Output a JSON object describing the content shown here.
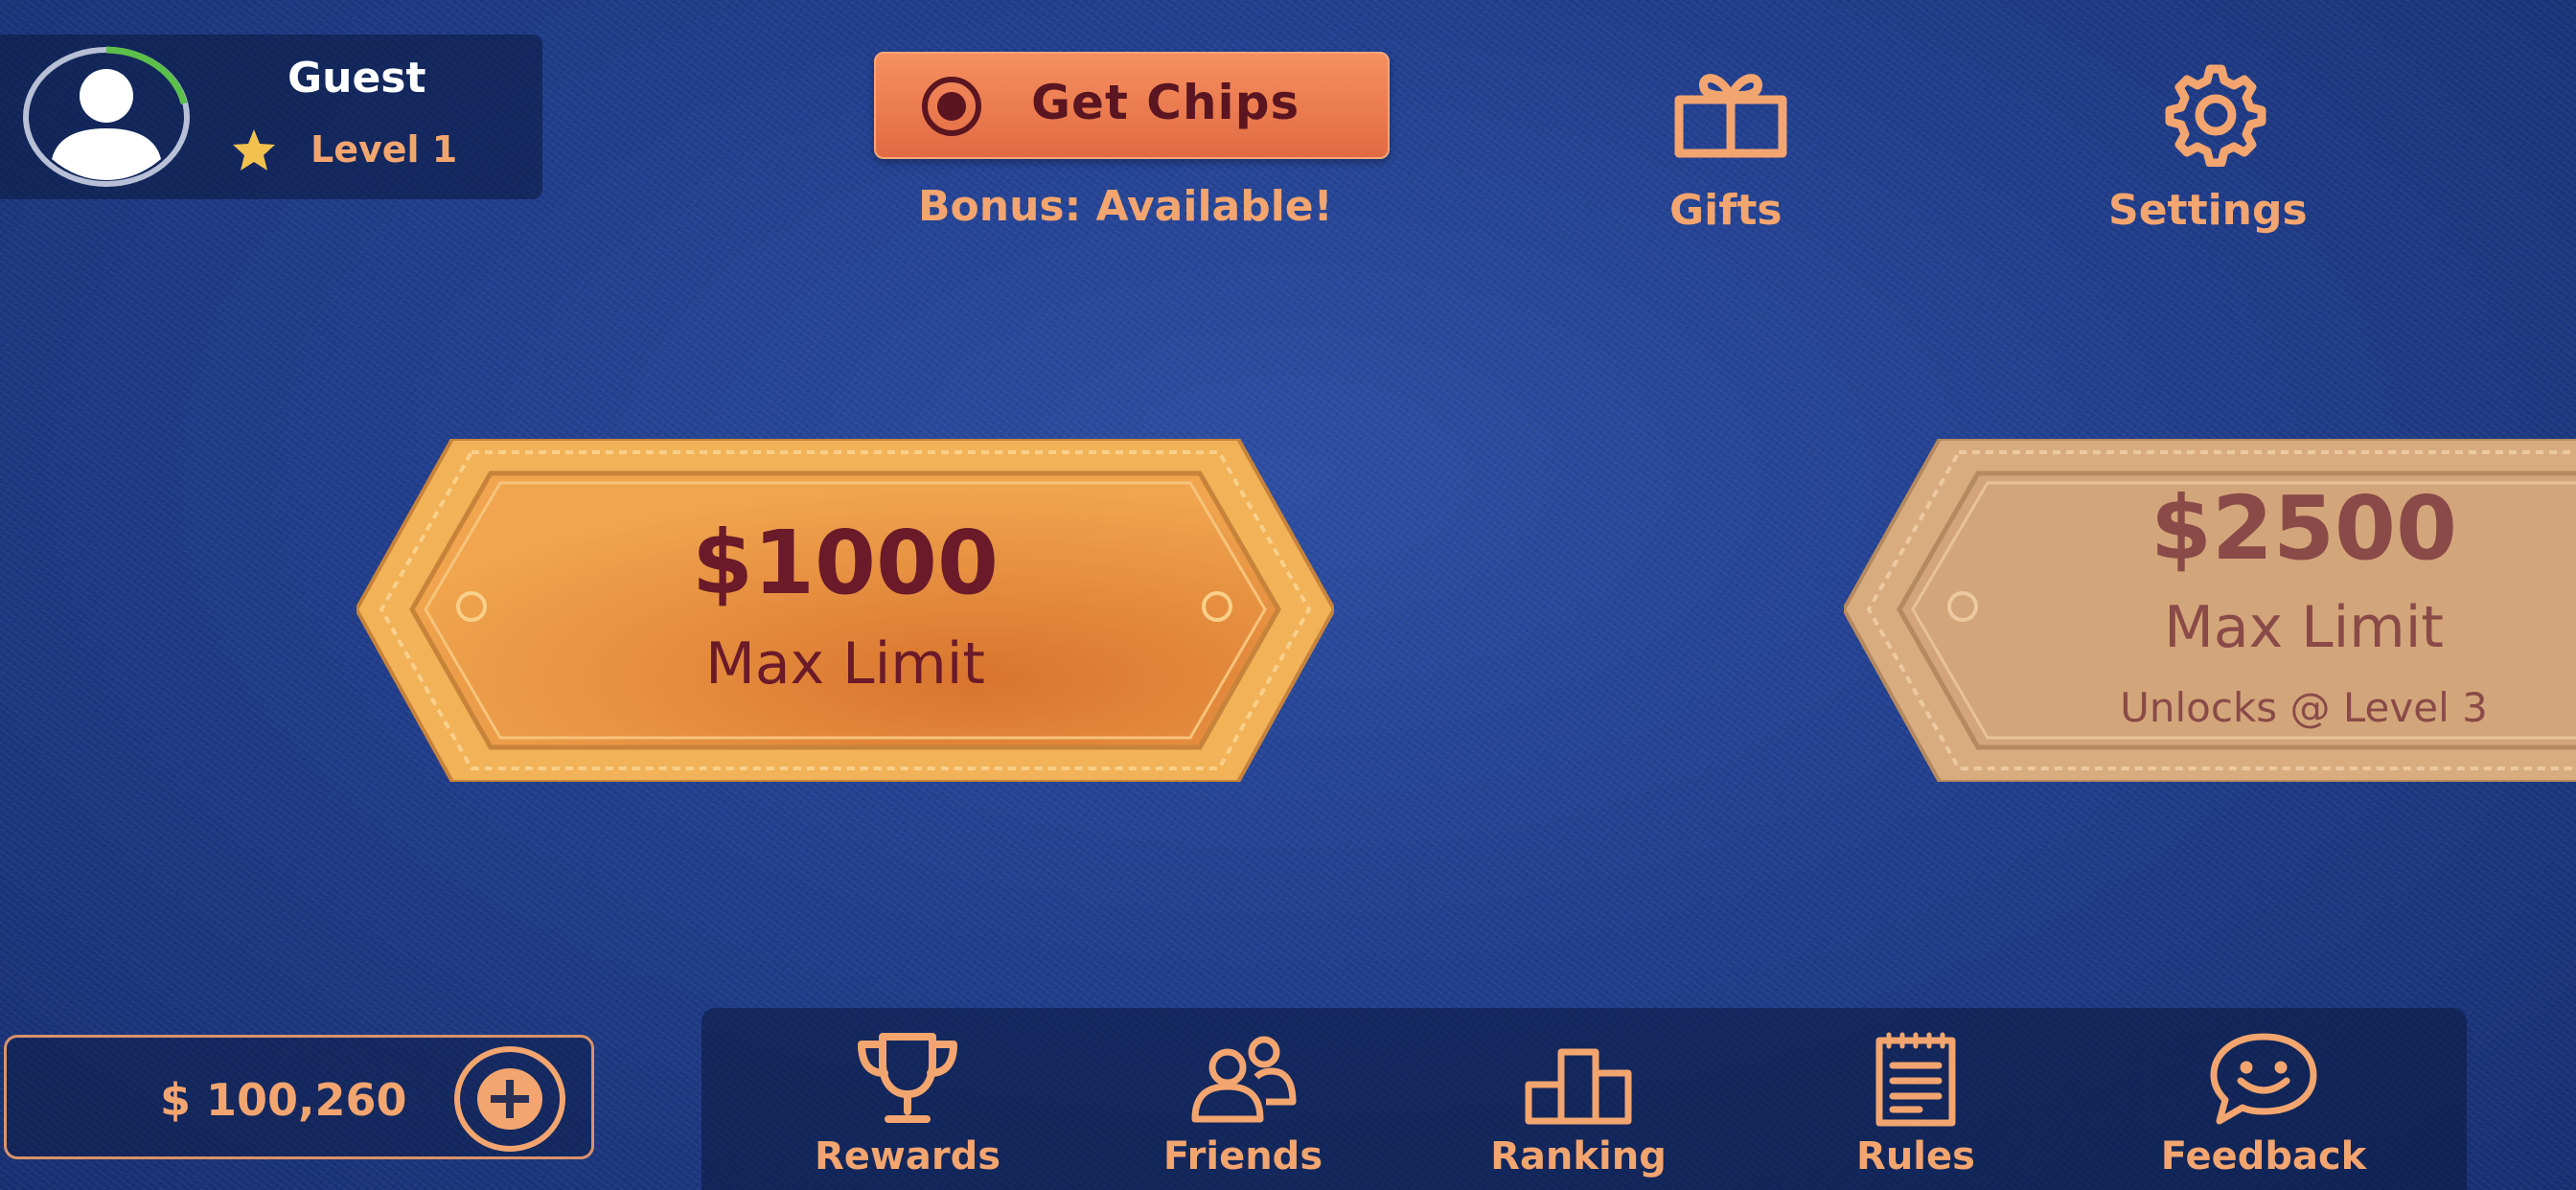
{
  "player": {
    "name": "Guest",
    "level_label": "Level 1"
  },
  "header": {
    "get_chips_label": "Get Chips",
    "bonus_text": "Bonus: Available!",
    "gifts_label": "Gifts",
    "settings_label": "Settings"
  },
  "tiers": [
    {
      "amount": "$1000",
      "subtitle": "Max Limit",
      "locked_text": ""
    },
    {
      "amount": "$2500",
      "subtitle": "Max Limit",
      "locked_text": "Unlocks @ Level 3"
    }
  ],
  "balance": {
    "text": "$ 100,260"
  },
  "nav": {
    "rewards": "Rewards",
    "friends": "Friends",
    "ranking": "Ranking",
    "rules": "Rules",
    "feedback": "Feedback"
  },
  "colors": {
    "accent": "#f3a56f",
    "button": "#e26a42",
    "tier_text": "#6a1a28",
    "background": "#213f8f"
  },
  "icons": [
    "avatar-icon",
    "star-icon",
    "chip-icon",
    "gift-icon",
    "gear-icon",
    "plus-circle-icon",
    "trophy-icon",
    "friends-icon",
    "podium-icon",
    "clipboard-icon",
    "chat-smile-icon"
  ]
}
